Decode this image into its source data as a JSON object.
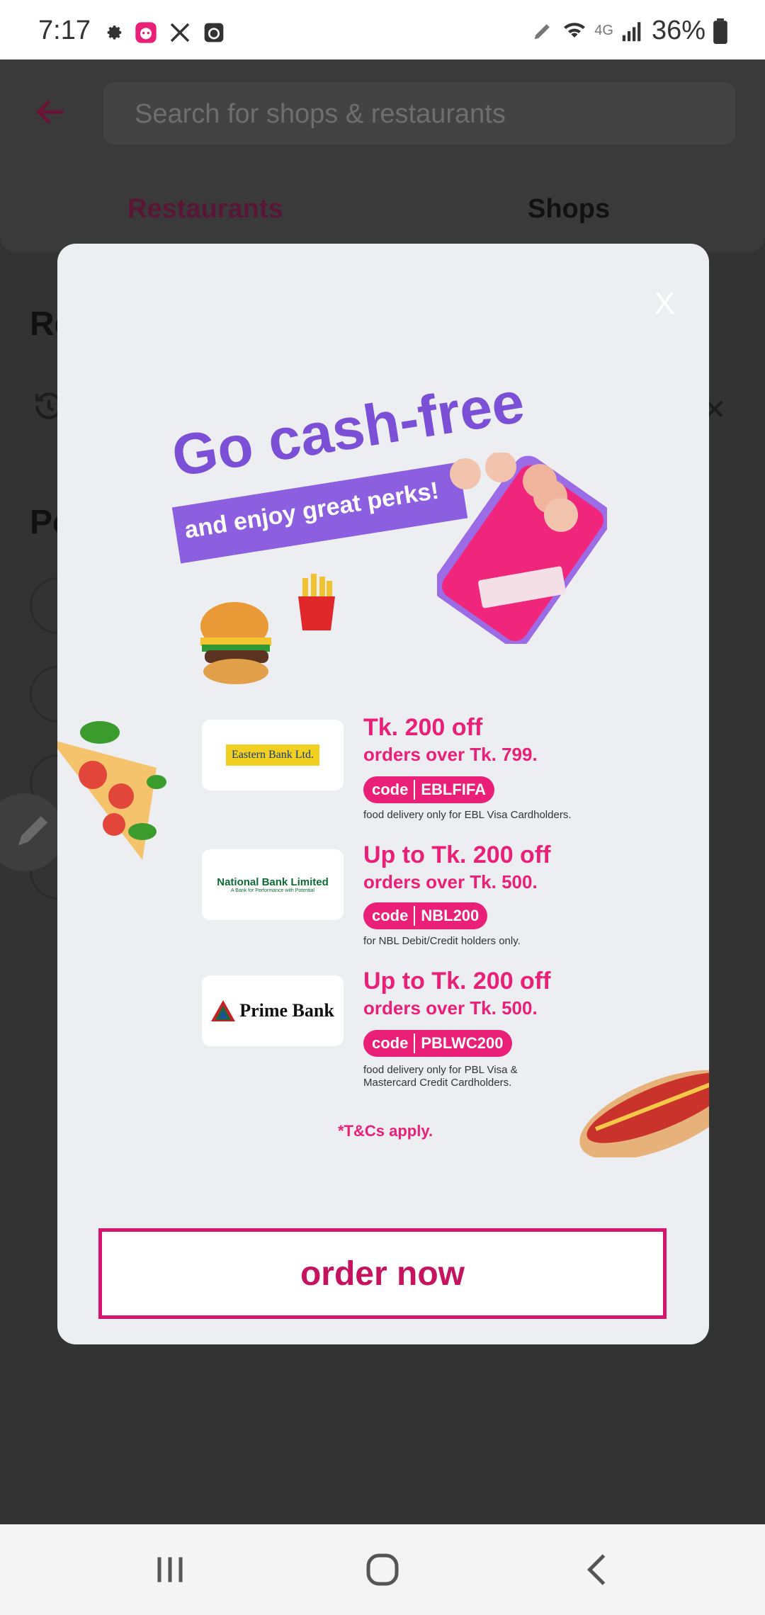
{
  "status_bar": {
    "time": "7:17",
    "network": "4G",
    "battery": "36%"
  },
  "header": {
    "search_placeholder": "Search for shops & restaurants",
    "tabs": [
      {
        "label": "Restaurants",
        "active": true
      },
      {
        "label": "Shops",
        "active": false
      }
    ]
  },
  "background": {
    "section_a_initial": "Re",
    "section_b_initial": "Po"
  },
  "modal": {
    "close_label": "X",
    "headline": "Go cash-free",
    "banner_text": "and enjoy great perks!",
    "offers": [
      {
        "bank": "Eastern Bank Ltd.",
        "title": "Tk. 200 off",
        "subtitle": "orders over Tk. 799.",
        "code_label": "code",
        "code": "EBLFIFA",
        "note": "food delivery only for EBL Visa Cardholders."
      },
      {
        "bank": "National Bank Limited",
        "bank_tagline": "A Bank for Performance with Potential",
        "title": "Up to Tk. 200 off",
        "subtitle": "orders over Tk. 500.",
        "code_label": "code",
        "code": "NBL200",
        "note": "for NBL Debit/Credit holders only."
      },
      {
        "bank": "Prime Bank",
        "title": "Up to Tk. 200 off",
        "subtitle": "orders over Tk. 500.",
        "code_label": "code",
        "code": "PBLWC200",
        "note_line1": "food delivery only for PBL Visa &",
        "note_line2": "Mastercard Credit Cardholders."
      }
    ],
    "tnc": "*T&Cs apply.",
    "cta_label": "order now"
  },
  "colors": {
    "brand_pink": "#ea1f78",
    "cta_border": "#d7156f",
    "headline_purple": "#7b4fd6"
  }
}
